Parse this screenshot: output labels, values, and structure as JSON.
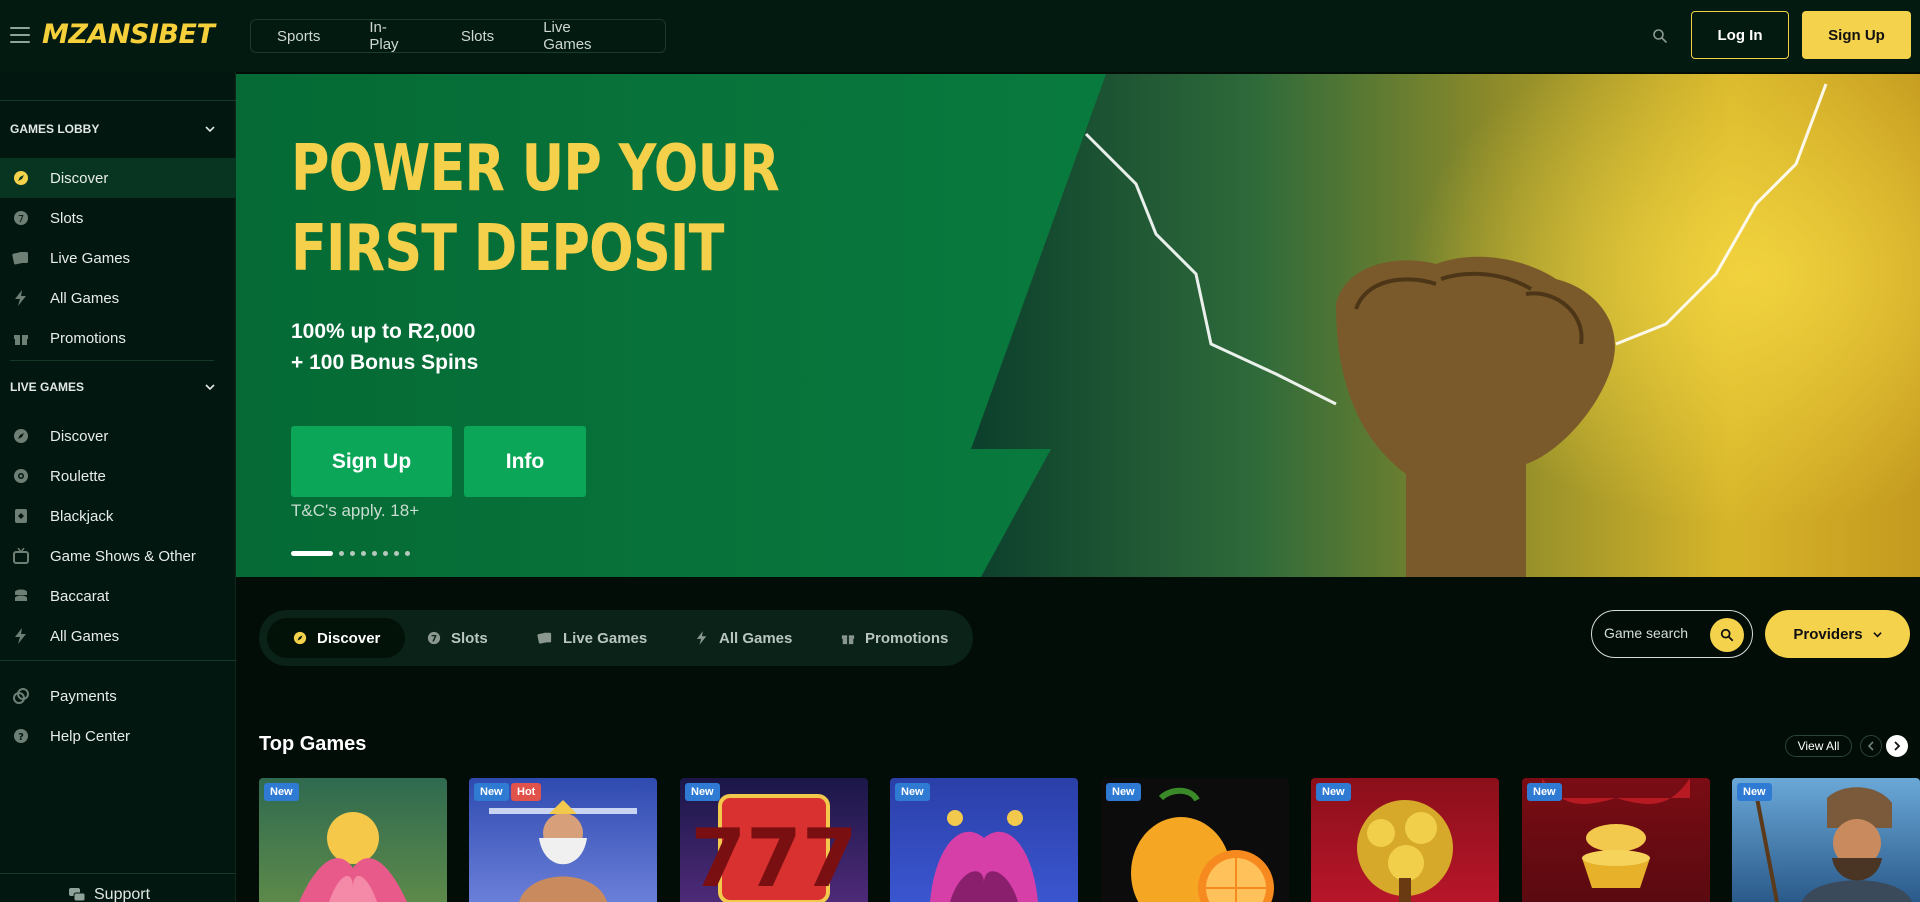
{
  "header": {
    "logo": "MZANSIBET",
    "nav": [
      "Sports",
      "In-Play",
      "Slots",
      "Live Games"
    ],
    "login_label": "Log In",
    "signup_label": "Sign Up"
  },
  "sidebar": {
    "games_lobby": {
      "title": "GAMES LOBBY",
      "items": [
        {
          "label": "Discover",
          "icon": "compass-icon"
        },
        {
          "label": "Slots",
          "icon": "slots-icon"
        },
        {
          "label": "Live Games",
          "icon": "cards-icon"
        },
        {
          "label": "All Games",
          "icon": "lightning-icon"
        },
        {
          "label": "Promotions",
          "icon": "gift-icon"
        }
      ]
    },
    "live_games": {
      "title": "LIVE GAMES",
      "items": [
        {
          "label": "Discover",
          "icon": "compass-icon"
        },
        {
          "label": "Roulette",
          "icon": "roulette-icon"
        },
        {
          "label": "Blackjack",
          "icon": "card-icon"
        },
        {
          "label": "Game Shows & Other",
          "icon": "tv-icon"
        },
        {
          "label": "Baccarat",
          "icon": "chips-icon"
        },
        {
          "label": "All Games",
          "icon": "lightning-icon"
        }
      ]
    },
    "footer_items": [
      {
        "label": "Payments",
        "icon": "coins-icon"
      },
      {
        "label": "Help Center",
        "icon": "help-icon"
      }
    ],
    "support_label": "Support"
  },
  "hero": {
    "title_line1": "POWER UP YOUR",
    "title_line2": "FIRST DEPOSIT",
    "sub_line1": "100% up to R2,000",
    "sub_line2": "+ 100 Bonus Spins",
    "signup_label": "Sign Up",
    "info_label": "Info",
    "terms": "T&C's apply. 18+",
    "slide_count": 9,
    "active_slide": 1
  },
  "categories": {
    "items": [
      {
        "label": "Discover",
        "icon": "compass-icon"
      },
      {
        "label": "Slots",
        "icon": "slots-icon"
      },
      {
        "label": "Live Games",
        "icon": "cards-icon"
      },
      {
        "label": "All Games",
        "icon": "lightning-icon"
      },
      {
        "label": "Promotions",
        "icon": "gift-icon"
      }
    ],
    "active": "Discover"
  },
  "game_search": {
    "placeholder": "Game search"
  },
  "providers_label": "Providers",
  "top_games": {
    "title": "Top Games",
    "view_all": "View All",
    "tiles": [
      {
        "badges": [
          "New"
        ]
      },
      {
        "badges": [
          "New",
          "Hot"
        ]
      },
      {
        "badges": [
          "New"
        ]
      },
      {
        "badges": [
          "New"
        ]
      },
      {
        "badges": [
          "New"
        ]
      },
      {
        "badges": [
          "New"
        ]
      },
      {
        "badges": [
          "New"
        ]
      },
      {
        "badges": [
          "New"
        ]
      }
    ]
  },
  "colors": {
    "accent_yellow": "#f5d24b",
    "brand_green": "#0ca658",
    "badge_new": "#2f7bd4",
    "badge_hot": "#e0524a"
  }
}
